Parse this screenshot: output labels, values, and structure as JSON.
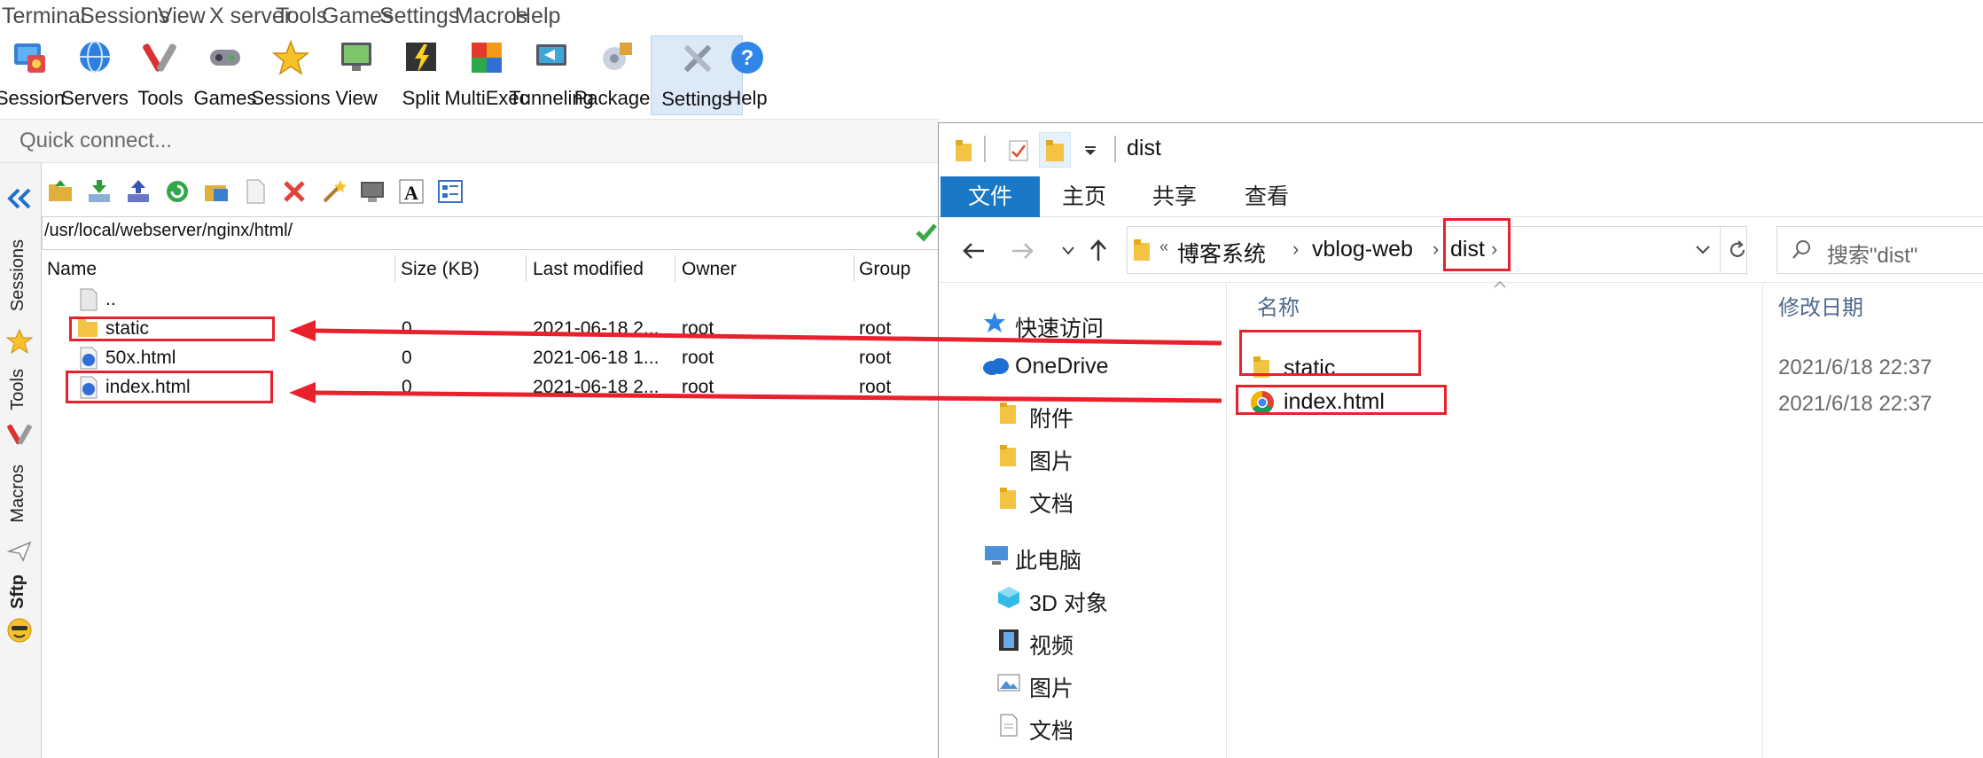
{
  "menu": [
    "Terminal",
    "Sessions",
    "View",
    "X server",
    "Tools",
    "Games",
    "Settings",
    "Macros",
    "Help"
  ],
  "toolbar": [
    "Session",
    "Servers",
    "Tools",
    "Games",
    "Sessions",
    "View",
    "Split",
    "MultiExec",
    "Tunneling",
    "Packages",
    "Settings",
    "Help"
  ],
  "quick_connect": {
    "placeholder": "Quick connect..."
  },
  "side_tabs": [
    "Sessions",
    "Tools",
    "Macros",
    "Sftp"
  ],
  "sftp": {
    "path": "/usr/local/webserver/nginx/html/",
    "columns": [
      "Name",
      "Size (KB)",
      "Last modified",
      "Owner",
      "Group"
    ],
    "rows": [
      {
        "name": "..",
        "size": "",
        "modified": "",
        "owner": "",
        "group": ""
      },
      {
        "name": "static",
        "size": "0",
        "modified": "2021-06-18 2...",
        "owner": "root",
        "group": "root"
      },
      {
        "name": "50x.html",
        "size": "0",
        "modified": "2021-06-18 1...",
        "owner": "root",
        "group": "root"
      },
      {
        "name": "index.html",
        "size": "0",
        "modified": "2021-06-18 2...",
        "owner": "root",
        "group": "root"
      }
    ]
  },
  "explorer": {
    "title": "dist",
    "ribbon_tabs": [
      "文件",
      "主页",
      "共享",
      "查看"
    ],
    "breadcrumb": [
      "博客系统",
      "vblog-web",
      "dist"
    ],
    "search_placeholder": "搜索\"dist\"",
    "nav": [
      "快速访问",
      "OneDrive",
      "附件",
      "图片",
      "文档",
      "此电脑",
      "3D 对象",
      "视频",
      "图片",
      "文档"
    ],
    "columns": [
      "名称",
      "修改日期"
    ],
    "files": [
      {
        "name": "static",
        "date": "2021/6/18 22:37"
      },
      {
        "name": "index.html",
        "date": "2021/6/18 22:37"
      }
    ]
  },
  "colors": {
    "annotation": "#e8212d",
    "ribbon_file": "#1a79c7",
    "folder": "#f3c443"
  }
}
